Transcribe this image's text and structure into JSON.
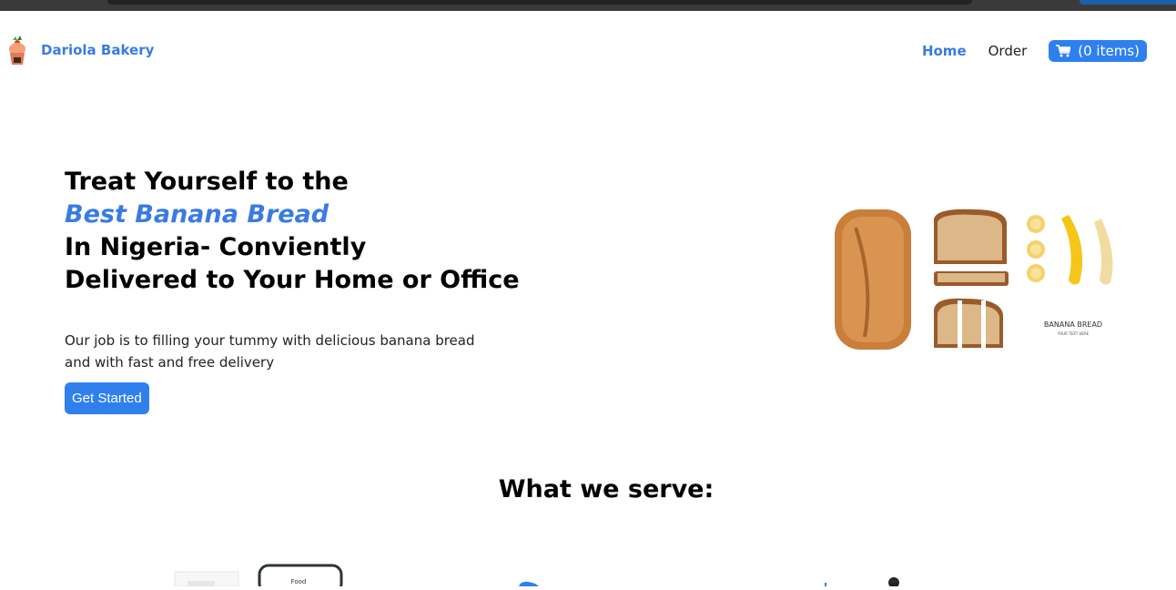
{
  "brand": {
    "name": "Dariola Bakery",
    "logo_icon": "cupcake-icon"
  },
  "nav": {
    "home": "Home",
    "order": "Order",
    "cart_label": "(0 items)",
    "cart_icon": "cart-icon"
  },
  "hero": {
    "title_line1": "Treat Yourself to the",
    "title_highlight": "Best Banana Bread",
    "title_line3": "In Nigeria- Conviently",
    "title_line4": "Delivered to Your Home or Office",
    "description": "Our job is to filling your tummy with delicious banana bread and with fast and free delivery",
    "cta": "Get Started",
    "image": {
      "title": "BANANA BREAD",
      "subtitle": "YOUR TEXT HERE"
    }
  },
  "serve": {
    "title": "What we serve:",
    "phone_label": "Food"
  },
  "colors": {
    "accent": "#3a7be0",
    "button": "#2f80ed"
  }
}
